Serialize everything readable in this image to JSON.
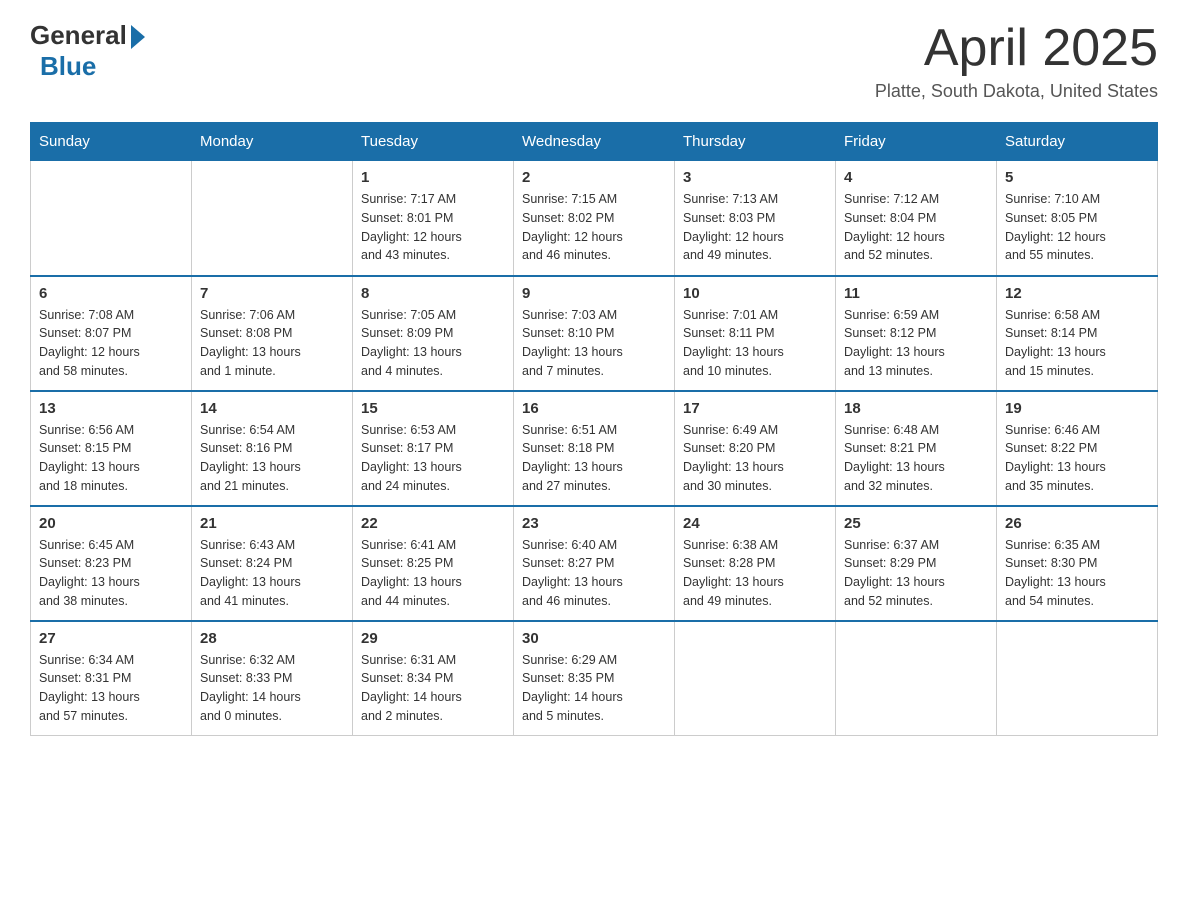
{
  "logo": {
    "general": "General",
    "blue": "Blue"
  },
  "title": {
    "month_year": "April 2025",
    "location": "Platte, South Dakota, United States"
  },
  "days_of_week": [
    "Sunday",
    "Monday",
    "Tuesday",
    "Wednesday",
    "Thursday",
    "Friday",
    "Saturday"
  ],
  "weeks": [
    [
      {
        "day": "",
        "info": ""
      },
      {
        "day": "",
        "info": ""
      },
      {
        "day": "1",
        "info": "Sunrise: 7:17 AM\nSunset: 8:01 PM\nDaylight: 12 hours\nand 43 minutes."
      },
      {
        "day": "2",
        "info": "Sunrise: 7:15 AM\nSunset: 8:02 PM\nDaylight: 12 hours\nand 46 minutes."
      },
      {
        "day": "3",
        "info": "Sunrise: 7:13 AM\nSunset: 8:03 PM\nDaylight: 12 hours\nand 49 minutes."
      },
      {
        "day": "4",
        "info": "Sunrise: 7:12 AM\nSunset: 8:04 PM\nDaylight: 12 hours\nand 52 minutes."
      },
      {
        "day": "5",
        "info": "Sunrise: 7:10 AM\nSunset: 8:05 PM\nDaylight: 12 hours\nand 55 minutes."
      }
    ],
    [
      {
        "day": "6",
        "info": "Sunrise: 7:08 AM\nSunset: 8:07 PM\nDaylight: 12 hours\nand 58 minutes."
      },
      {
        "day": "7",
        "info": "Sunrise: 7:06 AM\nSunset: 8:08 PM\nDaylight: 13 hours\nand 1 minute."
      },
      {
        "day": "8",
        "info": "Sunrise: 7:05 AM\nSunset: 8:09 PM\nDaylight: 13 hours\nand 4 minutes."
      },
      {
        "day": "9",
        "info": "Sunrise: 7:03 AM\nSunset: 8:10 PM\nDaylight: 13 hours\nand 7 minutes."
      },
      {
        "day": "10",
        "info": "Sunrise: 7:01 AM\nSunset: 8:11 PM\nDaylight: 13 hours\nand 10 minutes."
      },
      {
        "day": "11",
        "info": "Sunrise: 6:59 AM\nSunset: 8:12 PM\nDaylight: 13 hours\nand 13 minutes."
      },
      {
        "day": "12",
        "info": "Sunrise: 6:58 AM\nSunset: 8:14 PM\nDaylight: 13 hours\nand 15 minutes."
      }
    ],
    [
      {
        "day": "13",
        "info": "Sunrise: 6:56 AM\nSunset: 8:15 PM\nDaylight: 13 hours\nand 18 minutes."
      },
      {
        "day": "14",
        "info": "Sunrise: 6:54 AM\nSunset: 8:16 PM\nDaylight: 13 hours\nand 21 minutes."
      },
      {
        "day": "15",
        "info": "Sunrise: 6:53 AM\nSunset: 8:17 PM\nDaylight: 13 hours\nand 24 minutes."
      },
      {
        "day": "16",
        "info": "Sunrise: 6:51 AM\nSunset: 8:18 PM\nDaylight: 13 hours\nand 27 minutes."
      },
      {
        "day": "17",
        "info": "Sunrise: 6:49 AM\nSunset: 8:20 PM\nDaylight: 13 hours\nand 30 minutes."
      },
      {
        "day": "18",
        "info": "Sunrise: 6:48 AM\nSunset: 8:21 PM\nDaylight: 13 hours\nand 32 minutes."
      },
      {
        "day": "19",
        "info": "Sunrise: 6:46 AM\nSunset: 8:22 PM\nDaylight: 13 hours\nand 35 minutes."
      }
    ],
    [
      {
        "day": "20",
        "info": "Sunrise: 6:45 AM\nSunset: 8:23 PM\nDaylight: 13 hours\nand 38 minutes."
      },
      {
        "day": "21",
        "info": "Sunrise: 6:43 AM\nSunset: 8:24 PM\nDaylight: 13 hours\nand 41 minutes."
      },
      {
        "day": "22",
        "info": "Sunrise: 6:41 AM\nSunset: 8:25 PM\nDaylight: 13 hours\nand 44 minutes."
      },
      {
        "day": "23",
        "info": "Sunrise: 6:40 AM\nSunset: 8:27 PM\nDaylight: 13 hours\nand 46 minutes."
      },
      {
        "day": "24",
        "info": "Sunrise: 6:38 AM\nSunset: 8:28 PM\nDaylight: 13 hours\nand 49 minutes."
      },
      {
        "day": "25",
        "info": "Sunrise: 6:37 AM\nSunset: 8:29 PM\nDaylight: 13 hours\nand 52 minutes."
      },
      {
        "day": "26",
        "info": "Sunrise: 6:35 AM\nSunset: 8:30 PM\nDaylight: 13 hours\nand 54 minutes."
      }
    ],
    [
      {
        "day": "27",
        "info": "Sunrise: 6:34 AM\nSunset: 8:31 PM\nDaylight: 13 hours\nand 57 minutes."
      },
      {
        "day": "28",
        "info": "Sunrise: 6:32 AM\nSunset: 8:33 PM\nDaylight: 14 hours\nand 0 minutes."
      },
      {
        "day": "29",
        "info": "Sunrise: 6:31 AM\nSunset: 8:34 PM\nDaylight: 14 hours\nand 2 minutes."
      },
      {
        "day": "30",
        "info": "Sunrise: 6:29 AM\nSunset: 8:35 PM\nDaylight: 14 hours\nand 5 minutes."
      },
      {
        "day": "",
        "info": ""
      },
      {
        "day": "",
        "info": ""
      },
      {
        "day": "",
        "info": ""
      }
    ]
  ],
  "accent_color": "#1a6ea8"
}
